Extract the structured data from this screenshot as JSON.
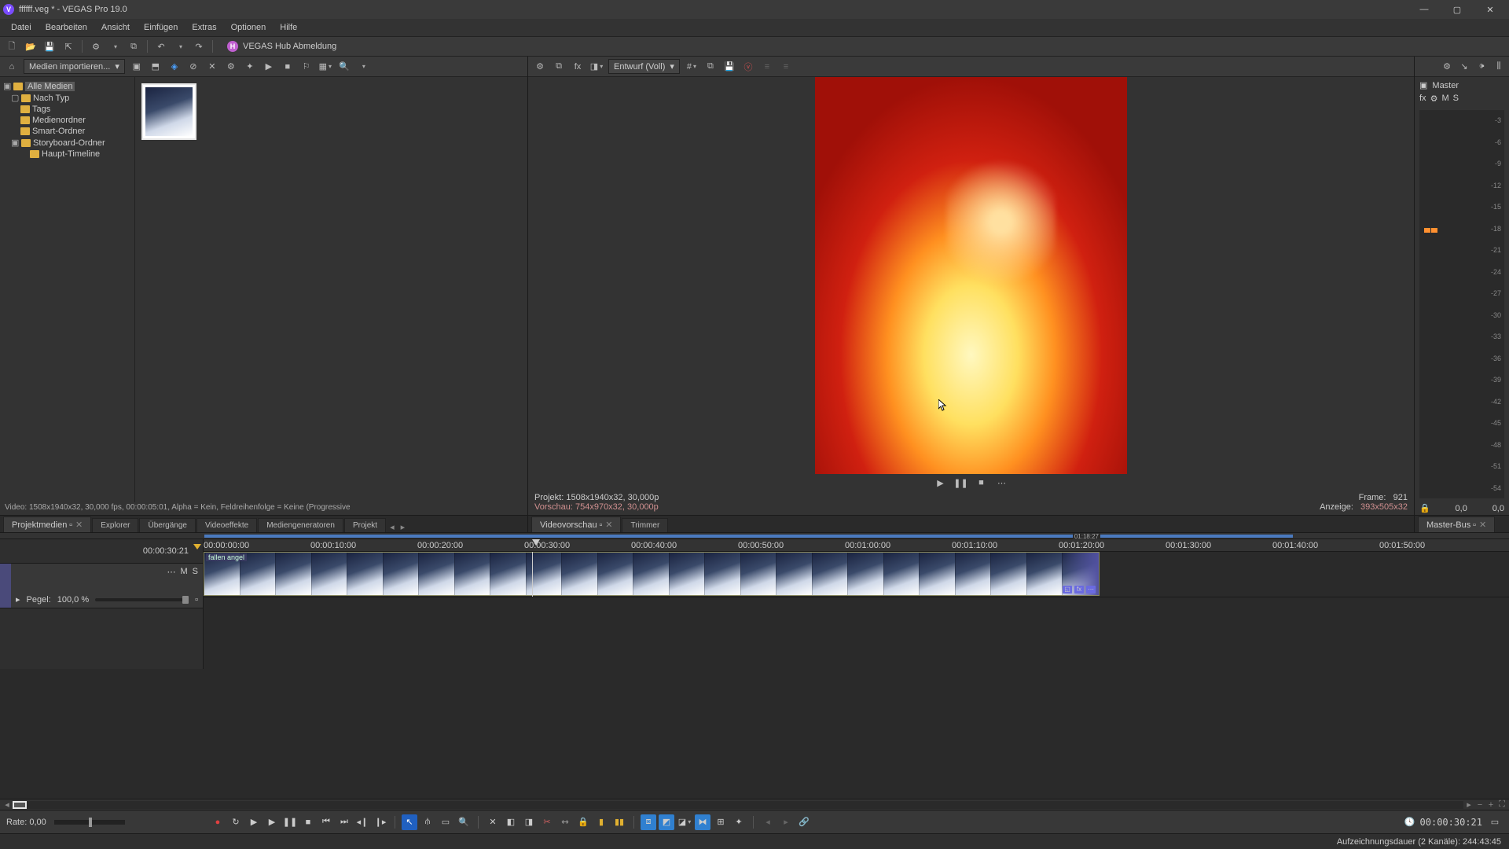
{
  "window": {
    "title": "ffffff.veg * - VEGAS Pro 19.0"
  },
  "menu": [
    "Datei",
    "Bearbeiten",
    "Ansicht",
    "Einfügen",
    "Extras",
    "Optionen",
    "Hilfe"
  ],
  "hub": {
    "label": "VEGAS Hub Abmeldung"
  },
  "media_panel": {
    "import_label": "Medien importieren...",
    "tree": {
      "root": "Alle Medien",
      "items": [
        "Nach Typ",
        "Tags",
        "Medienordner",
        "Smart-Ordner",
        "Storyboard-Ordner"
      ],
      "sub": "Haupt-Timeline"
    },
    "video_info": "Video:  1508x1940x32, 30,000 fps, 00:00:05:01, Alpha = Kein, Feldreihenfolge = Keine (Progressive"
  },
  "left_tabs": [
    "Projektmedien",
    "Explorer",
    "Übergänge",
    "Videoeffekte",
    "Mediengeneratoren",
    "Projekt"
  ],
  "preview": {
    "quality": "Entwurf (Voll)",
    "projekt_line": "Projekt:    1508x1940x32, 30,000p",
    "vorschau_line": "Vorschau:  754x970x32, 30,000p",
    "frame_label": "Frame:",
    "frame_value": "921",
    "anzeige_label": "Anzeige:",
    "anzeige_value": "393x505x32"
  },
  "right_tabs": [
    "Videovorschau",
    "Trimmer"
  ],
  "master": {
    "title": "Master",
    "sub": [
      "fx",
      "⚙",
      "M",
      "S"
    ],
    "scale": [
      "-3",
      "-6",
      "-9",
      "-12",
      "-15",
      "-18",
      "-21",
      "-24",
      "-27",
      "-30",
      "-33",
      "-36",
      "-39",
      "-42",
      "-45",
      "-48",
      "-51",
      "-54"
    ],
    "foot_left": "0,0",
    "foot_right": "0,0",
    "bus_tab": "Master-Bus"
  },
  "timeline": {
    "timecode": "00:00:30:21",
    "region_end": "01:18:27",
    "track": {
      "mute": "M",
      "solo": "S",
      "pegel_label": "Pegel:",
      "pegel_value": "100,0 %"
    },
    "ruler": [
      "00:00:00:00",
      "00:00:10:00",
      "00:00:20:00",
      "00:00:30:00",
      "00:00:40:00",
      "00:00:50:00",
      "00:01:00:00",
      "00:01:10:00",
      "00:01:20:00",
      "00:01:30:00",
      "00:01:40:00",
      "00:01:50:00"
    ],
    "clip_name": "fallen angel",
    "rate": "Rate: 0,00",
    "bottom_tc": "00:00:30:21"
  },
  "status": "Aufzeichnungsdauer (2 Kanäle): 244:43:45"
}
